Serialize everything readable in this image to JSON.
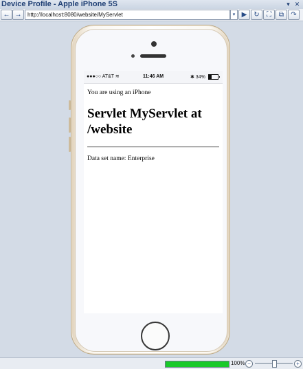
{
  "window": {
    "title": "Device Profile - Apple iPhone 5S",
    "menu_icon": "▾",
    "close_icon": "✕"
  },
  "toolbar": {
    "back_icon": "←",
    "forward_icon": "→",
    "url": "http://localhost:8080/website/MyServlet",
    "dropdown_icon": "▾",
    "go_icon": "▶",
    "refresh_icon": "↻",
    "fullscreen_icon": "⛶",
    "copy_icon": "⧉",
    "rotate_icon": "↷"
  },
  "device": {
    "carrier": "●●●○○ AT&T ≋",
    "time": "11:46 AM",
    "battery": "✱ 34%",
    "battery_level": 0.34
  },
  "page": {
    "using_text": "You are using an iPhone",
    "heading": "Servlet MyServlet at /website",
    "dataset_text": "Data set name: Enterprise"
  },
  "status_bar": {
    "zoom": "100%",
    "zoom_out_icon": "−",
    "zoom_in_icon": "+",
    "progress": 1.0
  },
  "colors": {
    "progress": "#19c92a",
    "title_text": "#1f3f74"
  }
}
